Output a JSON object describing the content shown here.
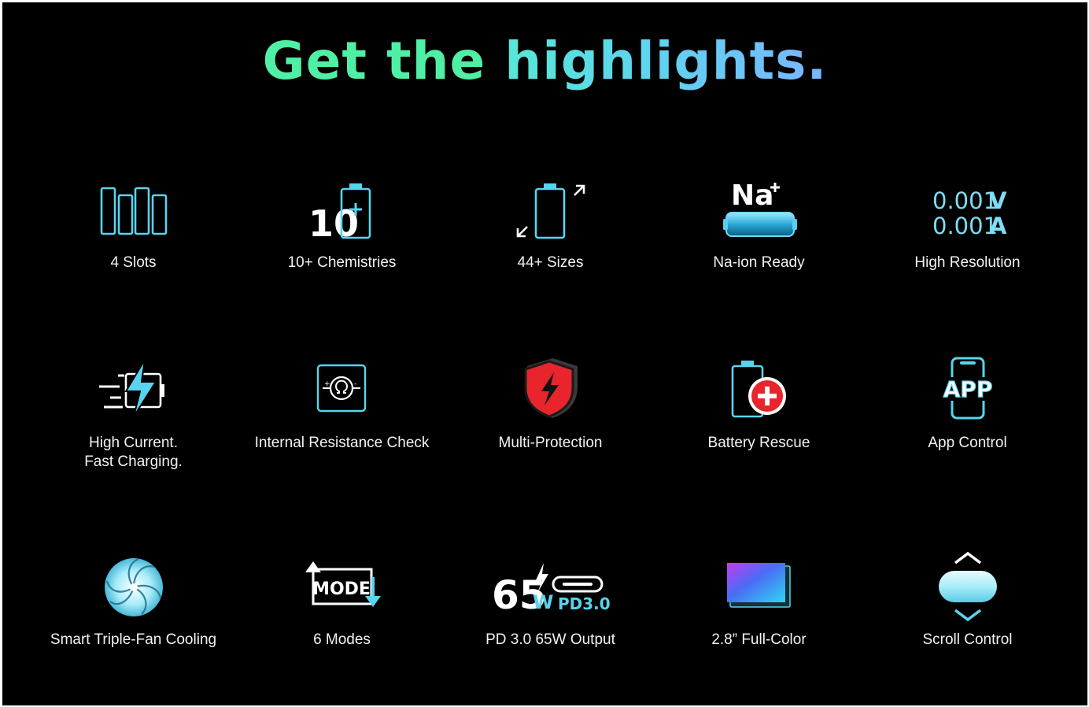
{
  "headline": {
    "part1": "Get the",
    "part2": "highlights."
  },
  "features": {
    "slots": {
      "label": "4 Slots",
      "icon": "battery-slots-icon"
    },
    "chemistries": {
      "label": "10+ Chemistries",
      "icon": "battery-plus-icon",
      "badge": "10"
    },
    "sizes": {
      "label": "44+ Sizes",
      "icon": "battery-resize-icon"
    },
    "naion": {
      "label": "Na-ion Ready",
      "icon": "sodium-battery-icon",
      "badge": "Na"
    },
    "resolution": {
      "label": "High Resolution",
      "icon": "readout-icon",
      "v_value": "0.001",
      "v_unit": "V",
      "a_value": "0.001",
      "a_unit": "A"
    },
    "current": {
      "line1": "High Current.",
      "line2": "Fast Charging.",
      "icon": "fast-charge-bolt-icon"
    },
    "resistance": {
      "label": "Internal Resistance Check",
      "icon": "ohm-icon"
    },
    "protection": {
      "label": "Multi-Protection",
      "icon": "shield-bolt-icon"
    },
    "rescue": {
      "label": "Battery Rescue",
      "icon": "battery-medical-cross-icon"
    },
    "app": {
      "label": "App Control",
      "icon": "phone-app-icon",
      "badge": "APP"
    },
    "cooling": {
      "label": "Smart Triple-Fan Cooling",
      "icon": "fan-icon"
    },
    "modes": {
      "label": "6 Modes",
      "icon": "mode-arrows-icon",
      "badge": "MODE"
    },
    "pd": {
      "label": "PD 3.0 65W Output",
      "icon": "usb-c-pd-icon",
      "watts": "65",
      "unit": "W",
      "pd": "PD3.0"
    },
    "display": {
      "label": "2.8” Full-Color",
      "icon": "color-screen-icon"
    },
    "scroll": {
      "label": "Scroll Control",
      "icon": "scroll-wheel-icon"
    }
  },
  "colors": {
    "background": "#000000",
    "accent": "#5fd3f0",
    "green": "#4ff0a6",
    "red": "#e8242c",
    "text": "#f2f2f2"
  }
}
